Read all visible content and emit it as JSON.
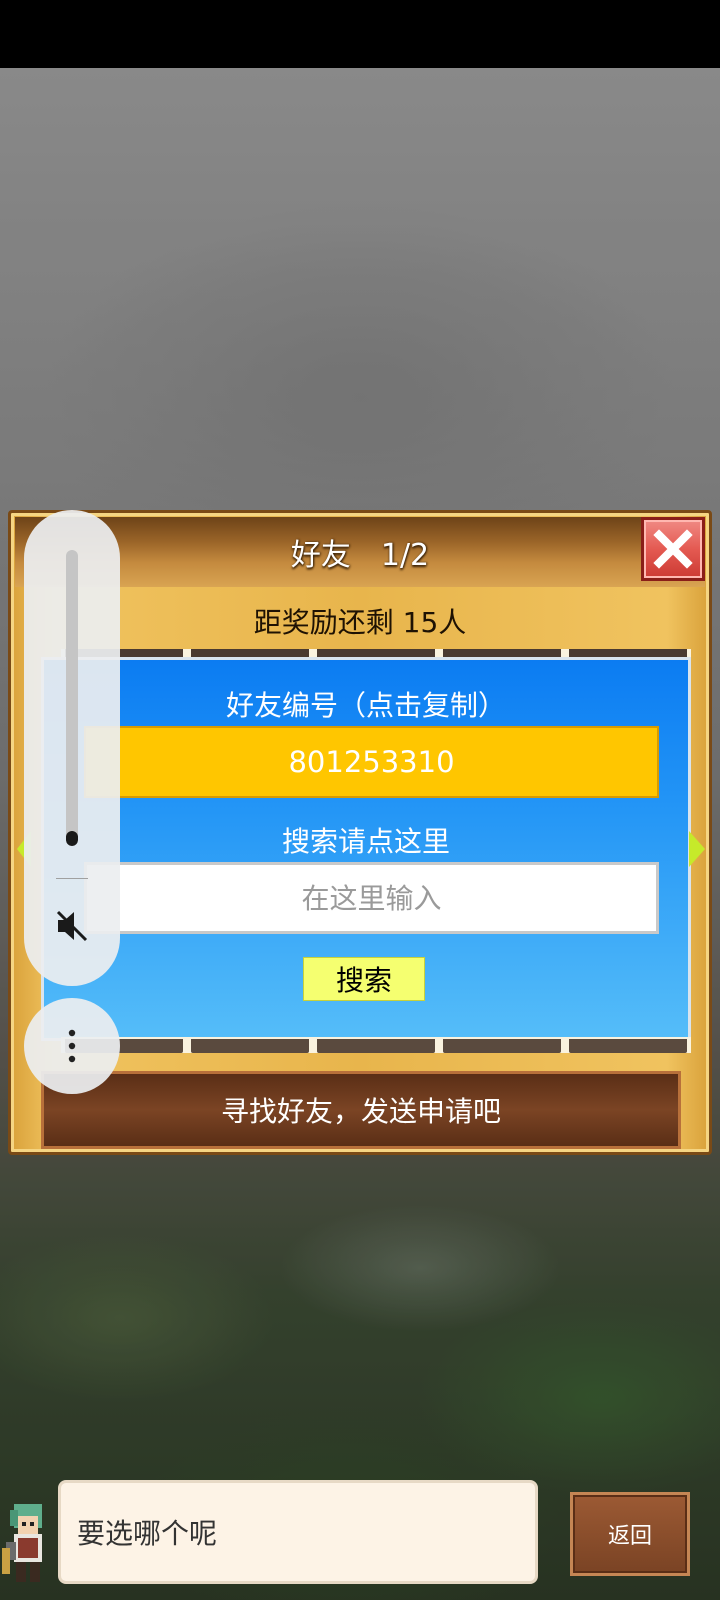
{
  "dialog": {
    "title": "好友　1/2",
    "reward_text": "距奖励还剩 15人",
    "id_label": "好友编号（点击复制）",
    "friend_id": "801253310",
    "search_label": "搜索请点这里",
    "search_placeholder": "在这里输入",
    "search_button": "搜索",
    "banner_text": "寻找好友，发送申请吧"
  },
  "message": {
    "text": "要选哪个呢"
  },
  "back_button": "返回",
  "volume": {
    "level": 0.05
  },
  "colors": {
    "friend_id_bg": "#ffc600",
    "panel_blue": "#1a8ff4",
    "search_button_bg": "#f5ff70",
    "close_red": "#e45a52"
  }
}
